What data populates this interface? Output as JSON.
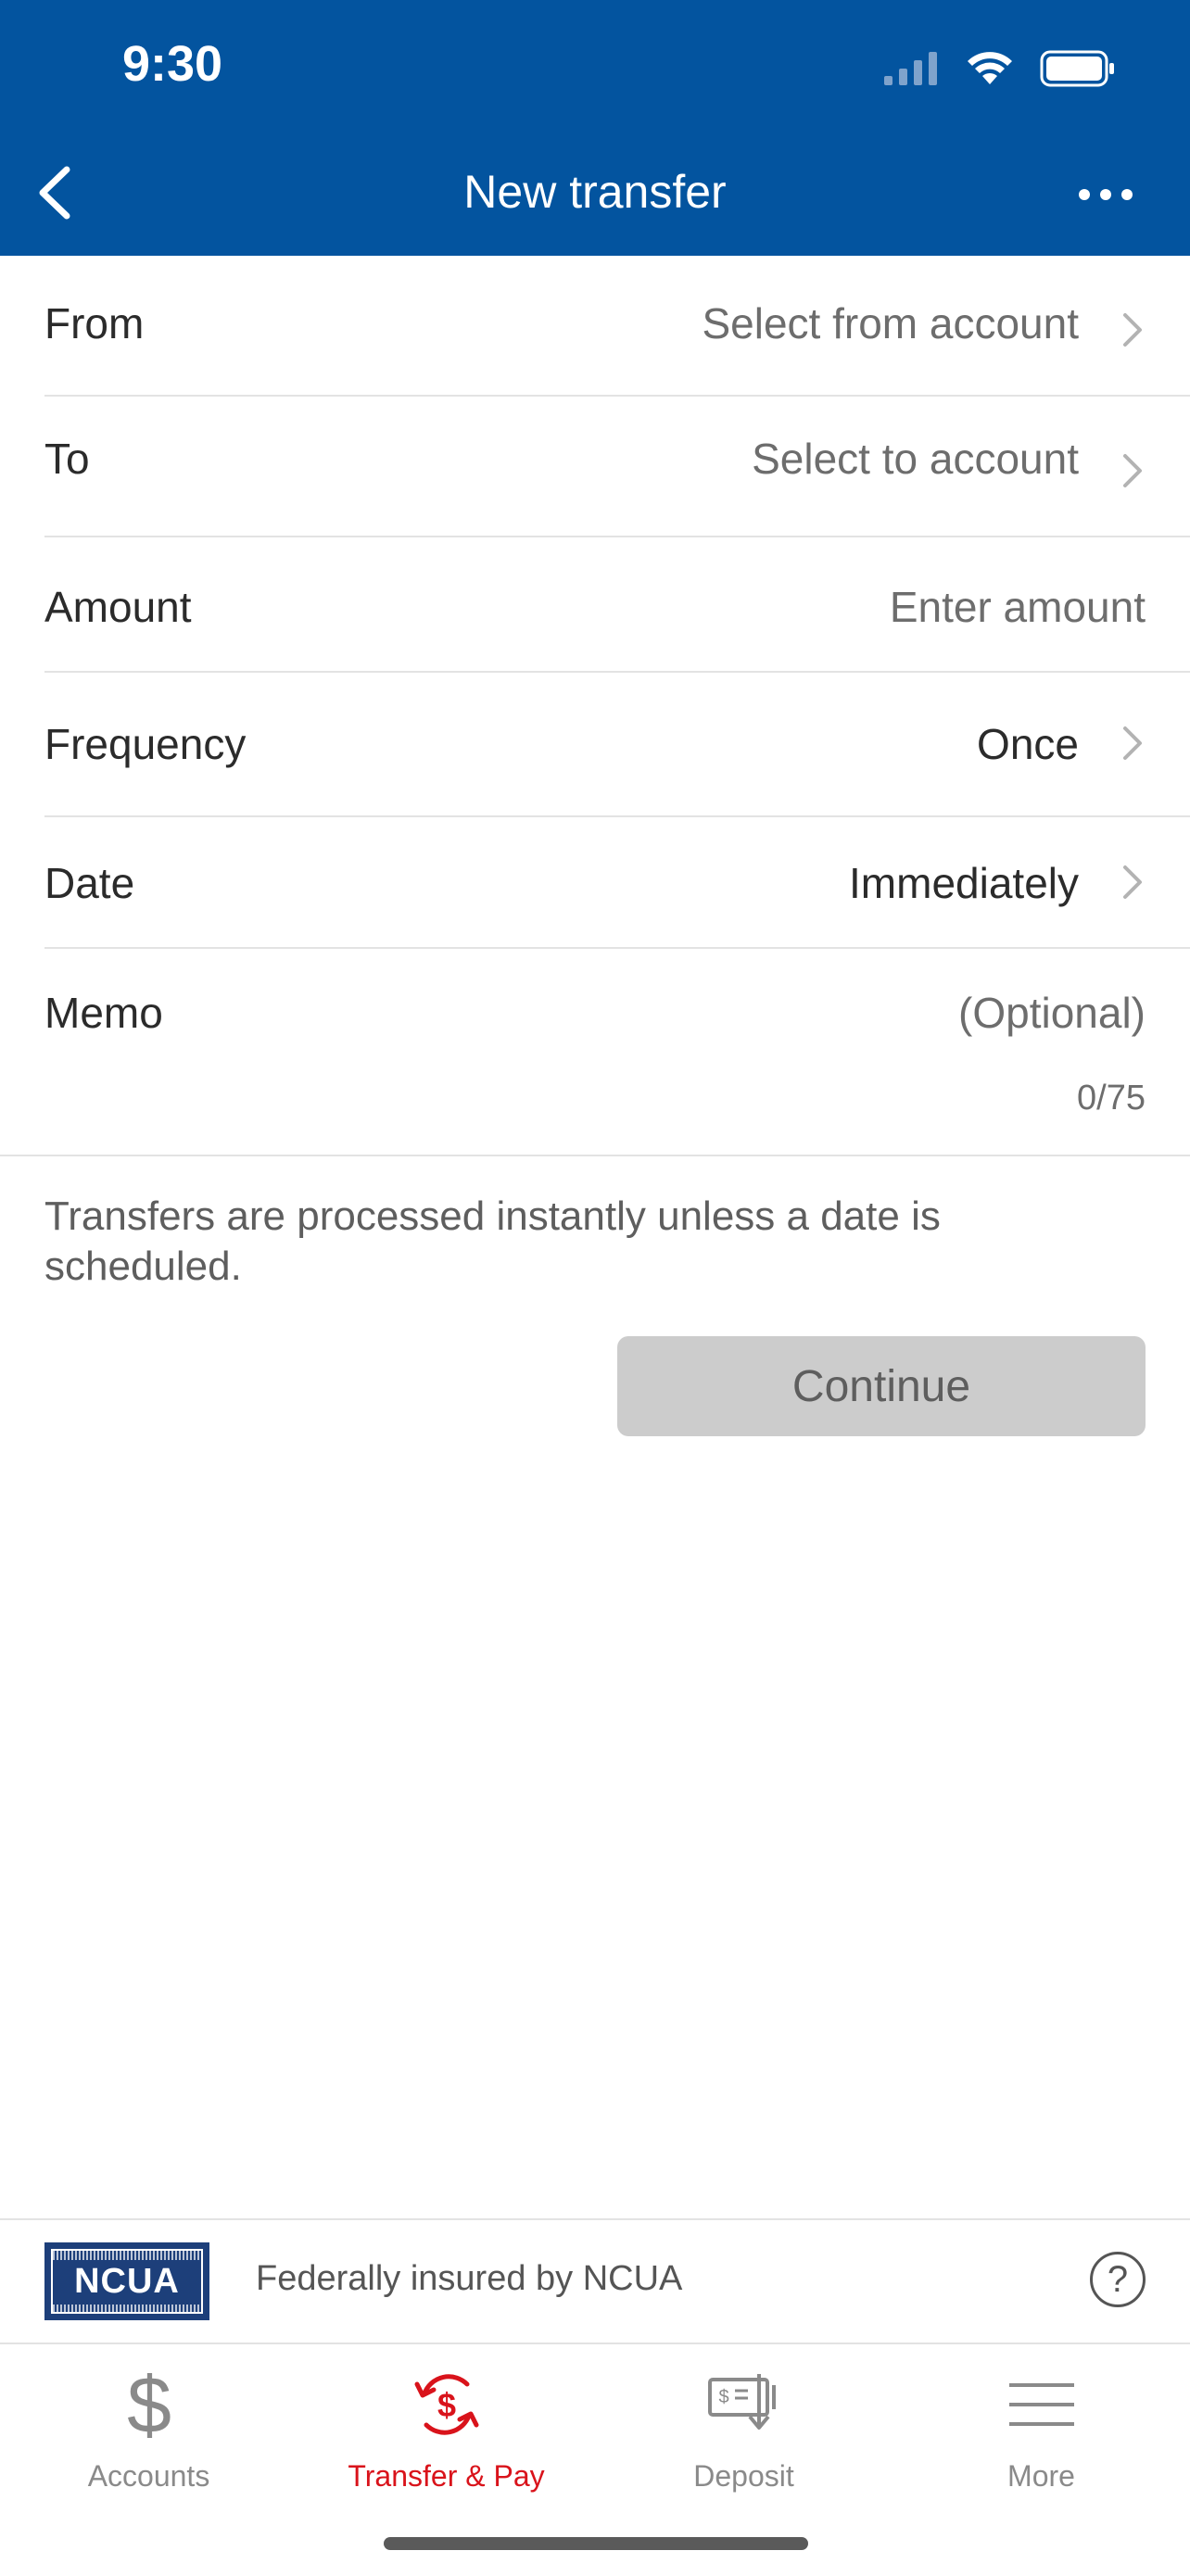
{
  "status_bar": {
    "time": "9:30"
  },
  "nav": {
    "title": "New transfer"
  },
  "form": {
    "from": {
      "label": "From",
      "value": "Select from account"
    },
    "to": {
      "label": "To",
      "value": "Select to account"
    },
    "amount": {
      "label": "Amount",
      "placeholder": "Enter amount"
    },
    "frequency": {
      "label": "Frequency",
      "value": "Once"
    },
    "date": {
      "label": "Date",
      "value": "Immediately"
    },
    "memo": {
      "label": "Memo",
      "placeholder": "(Optional)",
      "counter": "0/75"
    }
  },
  "info_text": "Transfers are processed instantly unless a date is scheduled.",
  "continue_label": "Continue",
  "ncua": {
    "logo_text": "NCUA",
    "caption": "Federally insured by NCUA"
  },
  "tabs": [
    {
      "label": "Accounts",
      "icon": "dollar-icon"
    },
    {
      "label": "Transfer & Pay",
      "icon": "transfer-icon",
      "active": true
    },
    {
      "label": "Deposit",
      "icon": "check-deposit-icon"
    },
    {
      "label": "More",
      "icon": "menu-icon"
    }
  ],
  "colors": {
    "header": "#03549f",
    "active_tab": "#d9131b",
    "disabled_button": "#cccccc"
  }
}
